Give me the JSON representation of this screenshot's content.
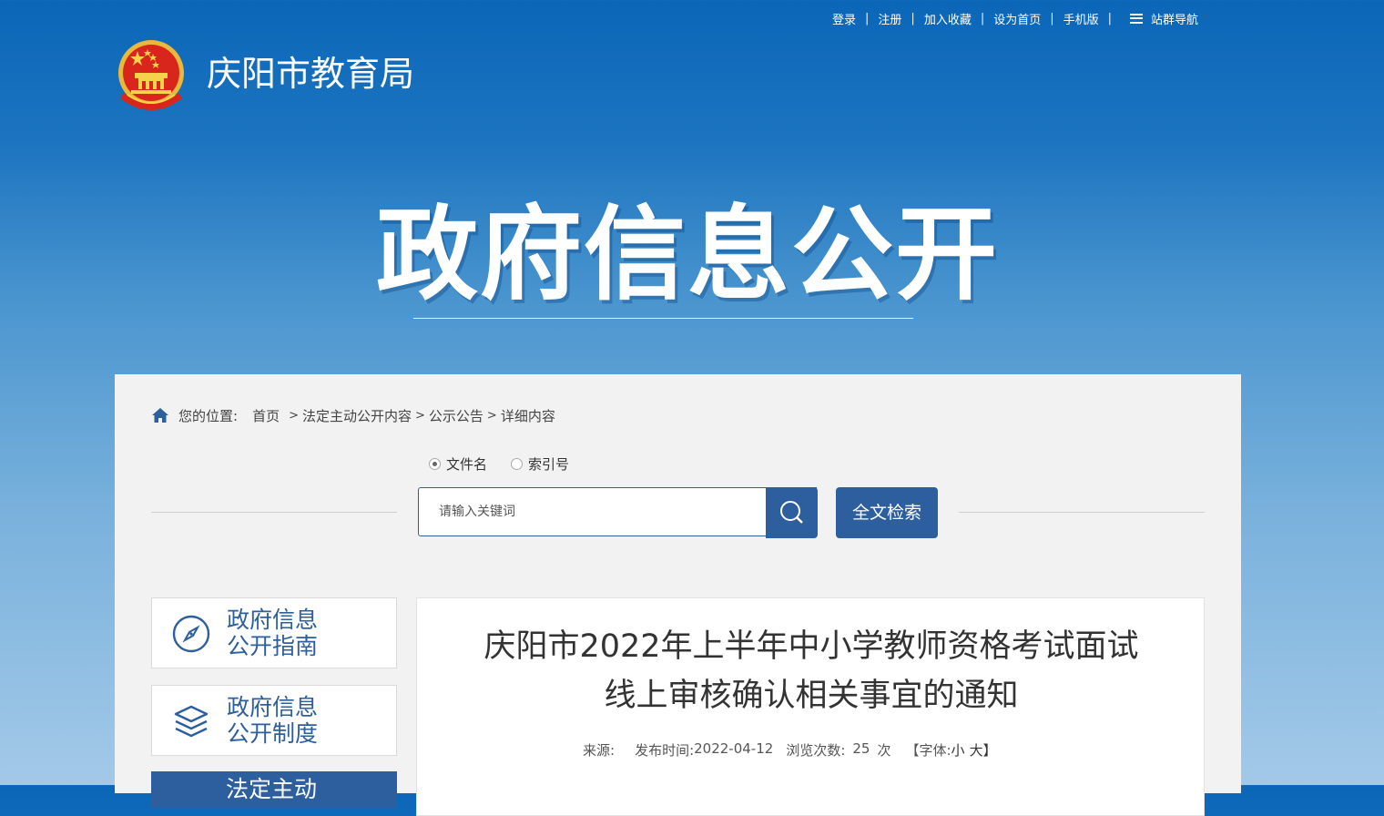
{
  "top_links": {
    "login": "登录",
    "register": "注册",
    "favorite": "加入收藏",
    "set_home": "设为首页",
    "mobile": "手机版",
    "site_nav": "站群导航"
  },
  "header": {
    "site_title": "庆阳市教育局"
  },
  "banner": {
    "title": "政府信息公开"
  },
  "breadcrumb": {
    "label": "您的位置:",
    "items": [
      "首页",
      "法定主动公开内容",
      "公示公告",
      "详细内容"
    ]
  },
  "search": {
    "radio_filename": "文件名",
    "radio_index": "索引号",
    "selected": "文件名",
    "placeholder": "请输入关键词",
    "fulltext_label": "全文检索"
  },
  "sidebar": {
    "guide_line1": "政府信息",
    "guide_line2": "公开指南",
    "system_line1": "政府信息",
    "system_line2": "公开制度",
    "third_partial": "法定主动"
  },
  "article": {
    "title_line1": "庆阳市2022年上半年中小学教师资格考试面试",
    "title_line2": "线上审核确认相关事宜的通知",
    "source_label": "来源:",
    "source_value": "",
    "date_label": "发布时间:",
    "date_value": "2022-04-12",
    "views_label": "浏览次数:",
    "views_value": "25",
    "views_unit": "次",
    "font_label": "【字体:",
    "font_small": "小",
    "font_large": "大】"
  },
  "colors": {
    "primary": "#2d5e9e",
    "header_top": "#0b66b8",
    "panel_bg": "#f2f2f2"
  }
}
